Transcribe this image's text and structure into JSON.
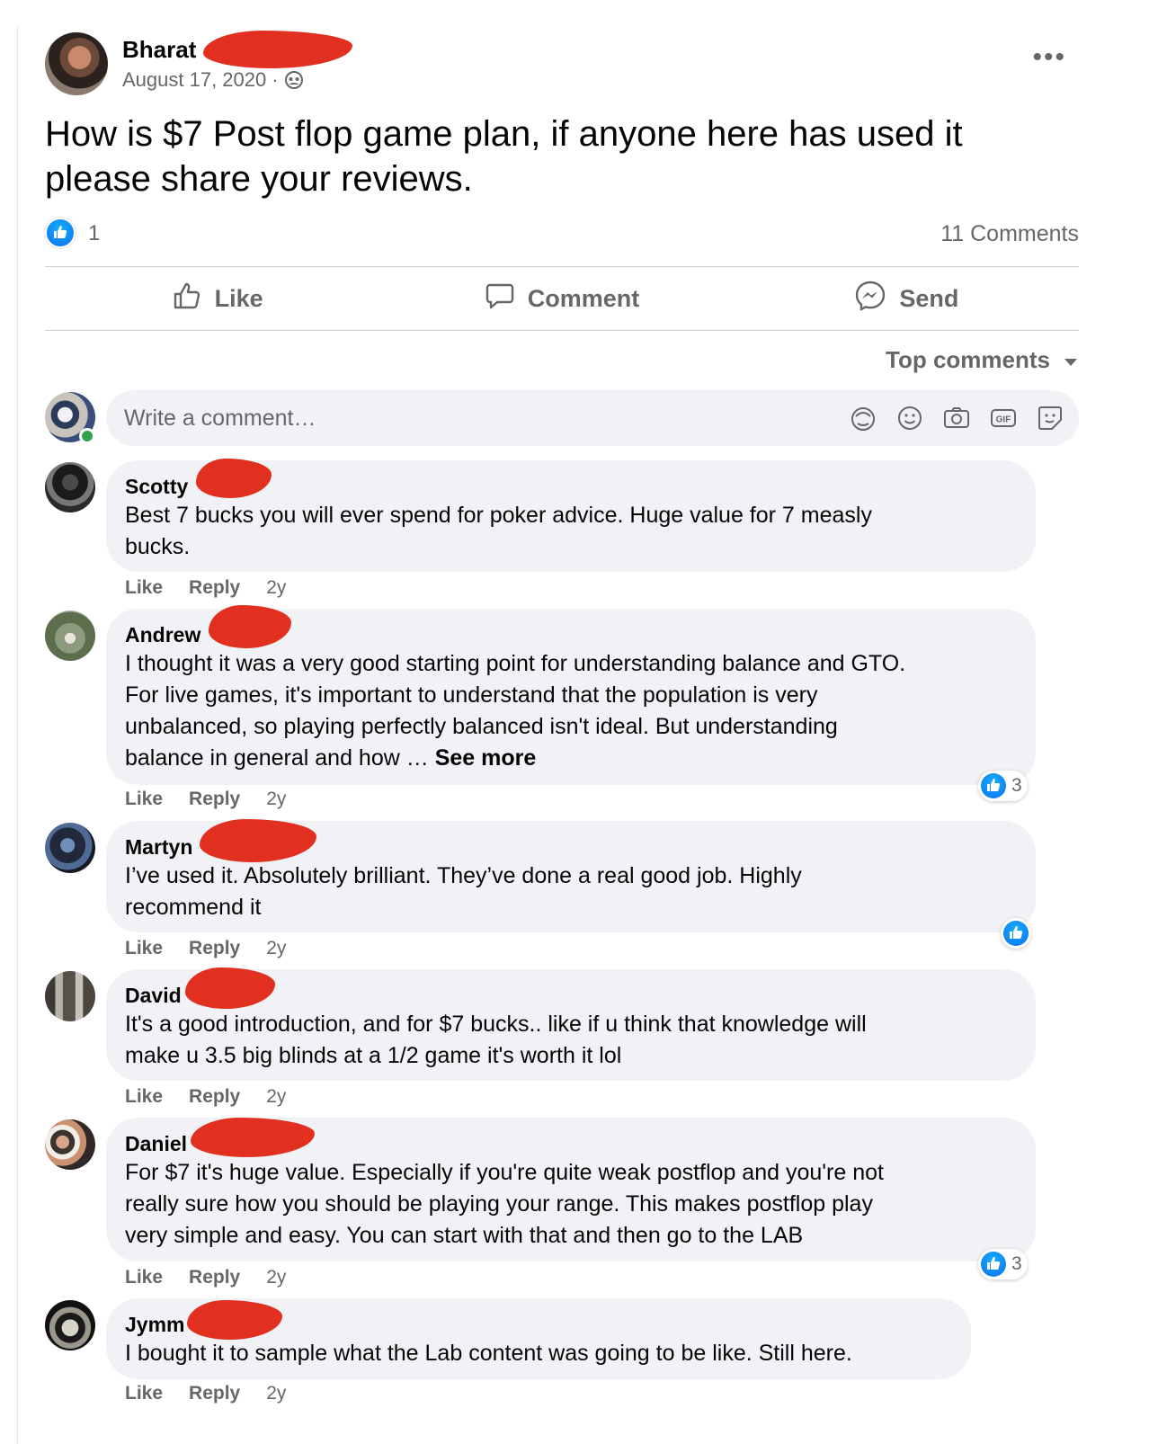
{
  "post": {
    "author": "Bharat",
    "date": "August 17, 2020",
    "date_separator": "·",
    "privacy_icon": "group-icon",
    "more_label": "•••",
    "text": "How is $7 Post flop game plan, if anyone here has used it please share your reviews.",
    "reaction_count": "1",
    "comments_count": "11 Comments"
  },
  "actions": {
    "like": "Like",
    "comment": "Comment",
    "send": "Send"
  },
  "sort": {
    "label": "Top comments"
  },
  "composer": {
    "placeholder": "Write a comment…",
    "icons": [
      "avatar-sticker-icon",
      "emoji-icon",
      "camera-icon",
      "gif-icon",
      "sticker-icon"
    ]
  },
  "comment_actions": {
    "like": "Like",
    "reply": "Reply"
  },
  "comments": [
    {
      "name": "Scotty",
      "text": "Best 7 bucks you will ever spend for poker advice. Huge value for 7 measly\nbucks.",
      "time": "2y",
      "reactions": ""
    },
    {
      "name": "Andrew",
      "text": "I thought it was a very good starting point for understanding balance and GTO.\nFor live games, it's important to understand that the population is very\nunbalanced, so playing perfectly balanced isn't ideal. But understanding\nbalance in general and how … ",
      "see_more": "See more",
      "time": "2y",
      "reactions": "3"
    },
    {
      "name": "Martyn",
      "text": "I’ve used it. Absolutely brilliant. They’ve done a real good job. Highly\nrecommend it",
      "time": "2y",
      "reactions": ""
    },
    {
      "name": "David",
      "text": "It's a good introduction, and for $7 bucks.. like if u think that knowledge will\nmake u 3.5 big blinds at a 1/2 game it's worth it lol",
      "time": "2y",
      "reactions": ""
    },
    {
      "name": "Daniel",
      "text": "For $7 it's huge value. Especially if you're quite weak postflop and you're not\nreally sure how you should be playing your range. This makes postflop play\nvery simple and easy. You can start with that and then go to the LAB",
      "time": "2y",
      "reactions": "3"
    },
    {
      "name": "Jymm",
      "text": "I bought it to sample what the Lab content was going to be like. Still here.",
      "time": "2y",
      "reactions": ""
    }
  ],
  "colors": {
    "accent_blue": "#1877f2",
    "redaction": "#e1301f",
    "bubble": "#f0f2f5",
    "secondary_text": "#65676b"
  }
}
